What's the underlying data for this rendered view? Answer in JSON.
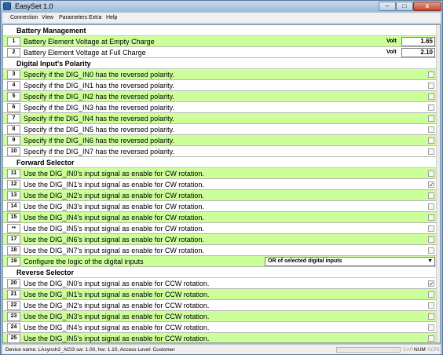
{
  "window": {
    "title": "EasySet 1.0",
    "min_label": "–",
    "max_label": "□",
    "close_label": "x"
  },
  "menu": [
    "Connection",
    "View",
    "Parameters",
    "Extra",
    "Help"
  ],
  "sections": {
    "battery": "Battery Management",
    "digital": "Digital Input's Polarity",
    "forward": "Forward Selector",
    "reverse": "Reverse Selector"
  },
  "rows": [
    {
      "num": "1",
      "label": "Battery Element Voltage at Empty Charge",
      "unit": "Volt",
      "value": "1.65"
    },
    {
      "num": "2",
      "label": "Battery Element Voltage at Full Charge",
      "unit": "Volt",
      "value": "2.10"
    },
    {
      "num": "3",
      "label": "Specify if the DIG_IN0 has the reversed polarity.",
      "checked": false
    },
    {
      "num": "4",
      "label": "Specify if the DIG_IN1 has the reversed polarity.",
      "checked": false
    },
    {
      "num": "5",
      "label": "Specify if the DIG_IN2 has the reversed polarity.",
      "checked": false
    },
    {
      "num": "6",
      "label": "Specify if the DIG_IN3 has the reversed polarity.",
      "checked": false
    },
    {
      "num": "7",
      "label": "Specify if the DIG_IN4 has the reversed polarity.",
      "checked": false
    },
    {
      "num": "8",
      "label": "Specify if the DIG_IN5 has the reversed polarity.",
      "checked": false
    },
    {
      "num": "9",
      "label": "Specify if the DIG_IN6 has the reversed polarity.",
      "checked": false
    },
    {
      "num": "10",
      "label": "Specify if the DIG_IN7 has the reversed polarity.",
      "checked": false
    },
    {
      "num": "11",
      "label": "Use the DIG_IN0's input signal as enable for CW rotation.",
      "checked": false
    },
    {
      "num": "12",
      "label": "Use the DIG_IN1's input signal as enable for CW rotation.",
      "checked": true
    },
    {
      "num": "13",
      "label": "Use the DIG_IN2's input signal as enable for CW rotation.",
      "checked": false
    },
    {
      "num": "14",
      "label": "Use the DIG_IN3's input signal as enable for CW rotation.",
      "checked": false
    },
    {
      "num": "15",
      "label": "Use the DIG_IN4's input signal as enable for CW rotation.",
      "checked": false
    },
    {
      "num": "••",
      "label": "Use the DIG_IN5's input signal as enable for CW rotation.",
      "checked": false
    },
    {
      "num": "17",
      "label": "Use the DIG_IN6's input signal as enable for CW rotation.",
      "checked": false
    },
    {
      "num": "18",
      "label": "Use the DIG_IN7's input signal as enable for CW rotation.",
      "checked": false
    },
    {
      "num": "19",
      "label": "Configure the logic of the digital inputs",
      "select": "OR of selected digital inputs"
    },
    {
      "num": "20",
      "label": "Use the DIG_IN0's input signal as enable for CCW rotation.",
      "checked": true
    },
    {
      "num": "21",
      "label": "Use the DIG_IN1's input signal as enable for CCW rotation.",
      "checked": false
    },
    {
      "num": "22",
      "label": "Use the DIG_IN2's input signal as enable for CCW rotation.",
      "checked": false
    },
    {
      "num": "23",
      "label": "Use the DIG_IN3's input signal as enable for CCW rotation.",
      "checked": false
    },
    {
      "num": "24",
      "label": "Use the DIG_IN4's input signal as enable for CCW rotation.",
      "checked": false
    },
    {
      "num": "25",
      "label": "Use the DIG_IN5's input signal as enable for CCW rotation.",
      "checked": false
    }
  ],
  "status": {
    "text": "Device name: LAsynch2_ACI3 sw: 1.00, hw: 1.10, Access Level: Customer",
    "cap": "CAP",
    "num": "NUM",
    "scrl": "SCRL"
  },
  "colors": {
    "row_highlight": "#ccff99",
    "titlebar": "#b2cbe4",
    "close_button": "#c24a33"
  },
  "icons": {
    "app": "app-icon",
    "dropdown": "chevron-down-icon",
    "check": "checkmark-icon"
  }
}
